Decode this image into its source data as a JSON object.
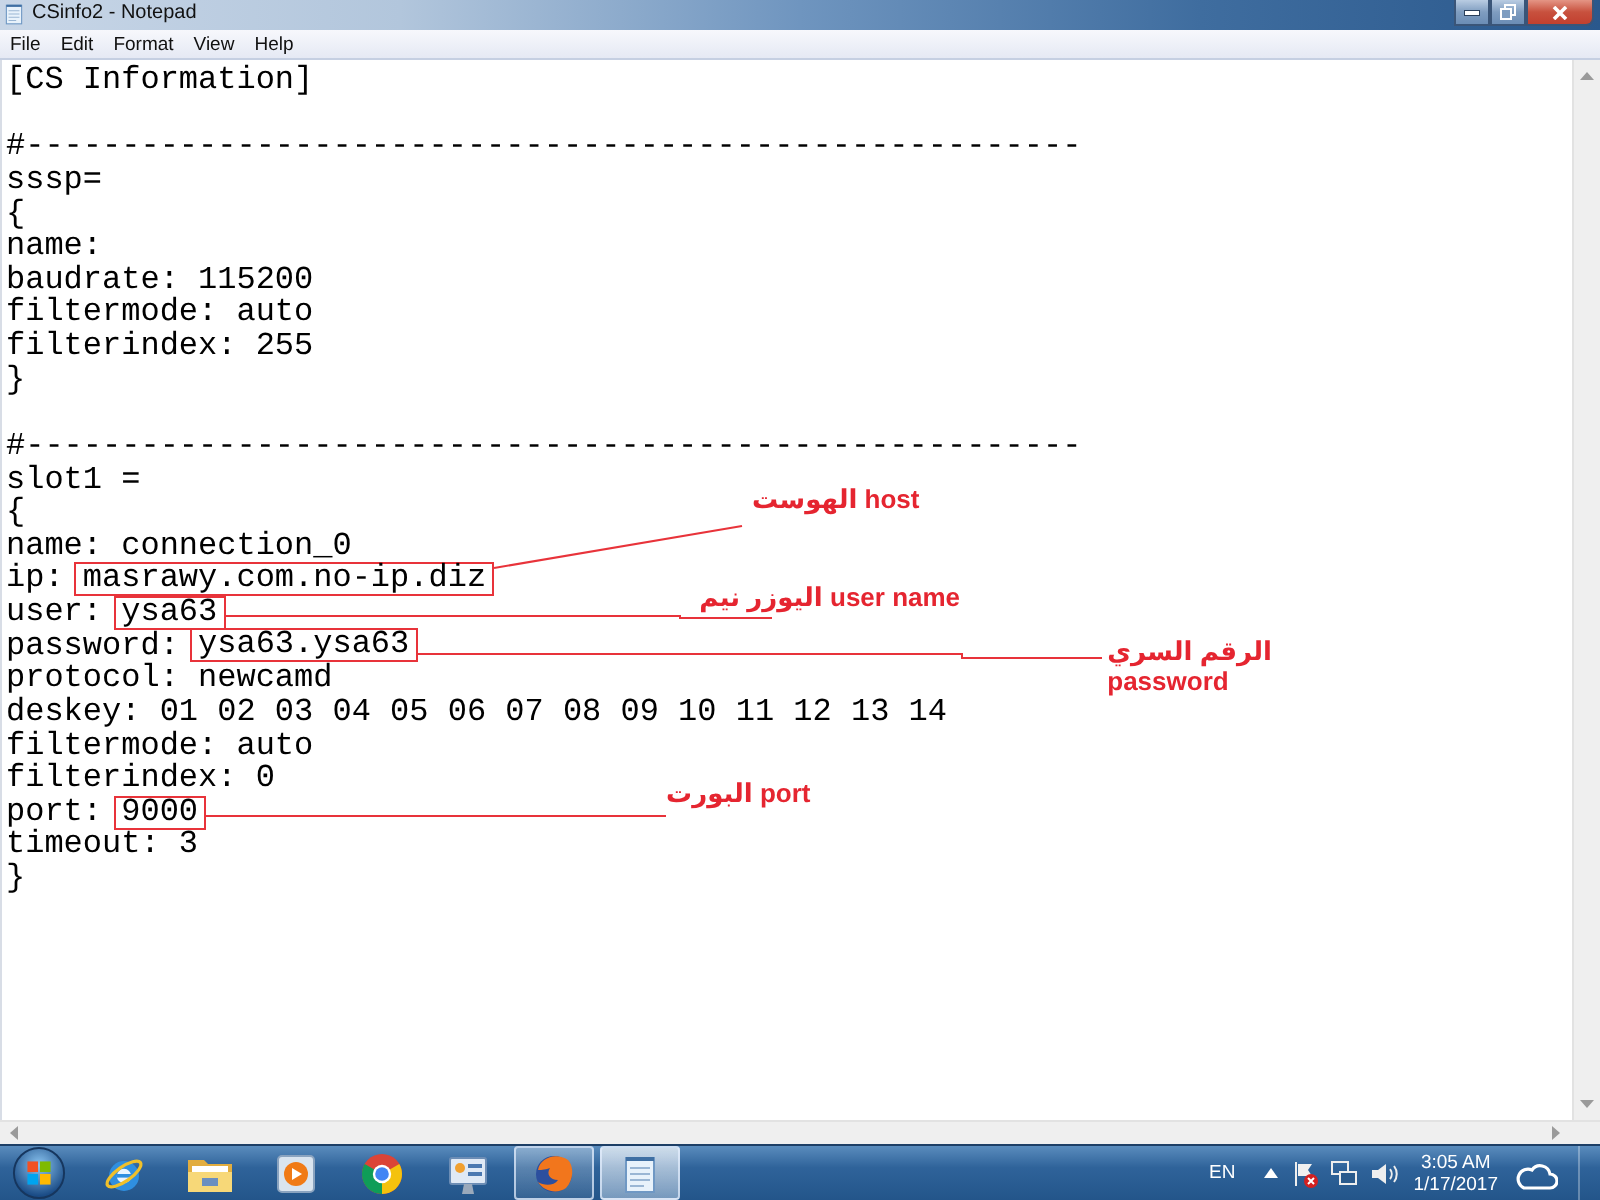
{
  "window": {
    "title": "CSinfo2 - Notepad"
  },
  "menu": [
    "File",
    "Edit",
    "Format",
    "View",
    "Help"
  ],
  "document": {
    "lines": [
      {
        "kind": "text",
        "text": "[CS Information]"
      },
      {
        "kind": "blank"
      },
      {
        "kind": "text",
        "text": "#-------------------------------------------------------"
      },
      {
        "kind": "text",
        "text": "sssp="
      },
      {
        "kind": "text",
        "text": "{"
      },
      {
        "kind": "text",
        "text": "name:"
      },
      {
        "kind": "text",
        "text": "baudrate: 115200"
      },
      {
        "kind": "text",
        "text": "filtermode: auto"
      },
      {
        "kind": "text",
        "text": "filterindex: 255"
      },
      {
        "kind": "text",
        "text": "}"
      },
      {
        "kind": "blank"
      },
      {
        "kind": "text",
        "text": "#-------------------------------------------------------"
      },
      {
        "kind": "text",
        "text": "slot1 ="
      },
      {
        "kind": "text",
        "text": "{"
      },
      {
        "kind": "text",
        "text": "name: connection_0"
      },
      {
        "kind": "annotated",
        "key": "ip:",
        "value": "masrawy.com.no-ip.diz",
        "note": [
          "الهوست host"
        ]
      },
      {
        "kind": "annotated",
        "key": "user:",
        "value": "ysa63",
        "note": [
          "اليوزر نيم user name"
        ]
      },
      {
        "kind": "annotated",
        "key": "password:",
        "value": "ysa63.ysa63",
        "note": [
          "الرقم السري",
          "password"
        ]
      },
      {
        "kind": "text",
        "text": "protocol: newcamd"
      },
      {
        "kind": "text",
        "text": "deskey: 01 02 03 04 05 06 07 08 09 10 11 12 13 14"
      },
      {
        "kind": "text",
        "text": "filtermode: auto"
      },
      {
        "kind": "text",
        "text": "filterindex: 0"
      },
      {
        "kind": "annotated",
        "key": "port:",
        "value": "9000",
        "note": [
          "البورت port"
        ]
      },
      {
        "kind": "text",
        "text": "timeout: 3"
      },
      {
        "kind": "text",
        "text": "}"
      }
    ]
  },
  "taskbar": {
    "items": [
      {
        "kind": "globe_e",
        "open": false,
        "selected": false
      },
      {
        "kind": "folder",
        "open": false,
        "selected": false
      },
      {
        "kind": "player",
        "open": false,
        "selected": false
      },
      {
        "kind": "pinwheel",
        "open": false,
        "selected": false
      },
      {
        "kind": "panel",
        "open": false,
        "selected": false
      },
      {
        "kind": "fox",
        "open": true,
        "selected": false
      },
      {
        "kind": "notepad",
        "open": true,
        "selected": true
      }
    ],
    "tray": {
      "language": "EN",
      "time": "3:05 AM",
      "date": "1/17/2017"
    }
  }
}
